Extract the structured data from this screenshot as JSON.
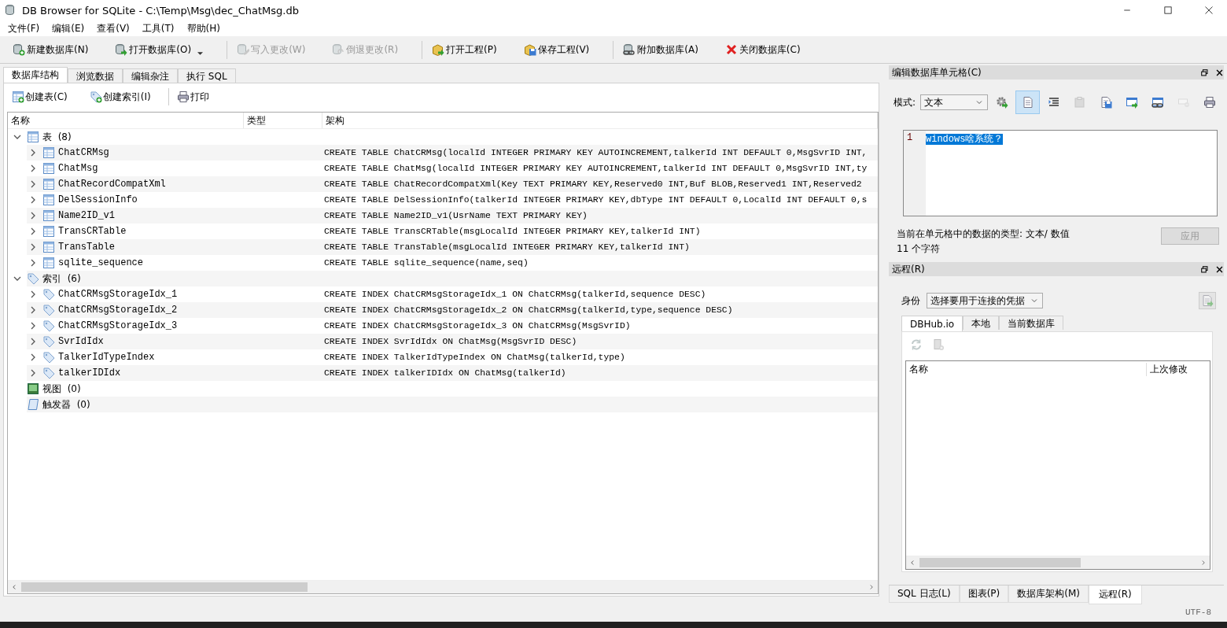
{
  "window": {
    "title": "DB Browser for SQLite - C:\\Temp\\Msg\\dec_ChatMsg.db"
  },
  "menu": [
    "文件(F)",
    "编辑(E)",
    "查看(V)",
    "工具(T)",
    "帮助(H)"
  ],
  "toolbar_groups": [
    {
      "buttons": [
        {
          "label": "新建数据库(N)",
          "disabled": false,
          "has_menu": false
        },
        {
          "label": "打开数据库(O)",
          "disabled": false,
          "has_menu": true
        }
      ]
    },
    {
      "buttons": [
        {
          "label": "写入更改(W)",
          "disabled": true,
          "has_menu": false
        },
        {
          "label": "倒退更改(R)",
          "disabled": true,
          "has_menu": false
        }
      ]
    },
    {
      "buttons": [
        {
          "label": "打开工程(P)",
          "disabled": false,
          "has_menu": false
        },
        {
          "label": "保存工程(V)",
          "disabled": false,
          "has_menu": false
        }
      ]
    },
    {
      "buttons": [
        {
          "label": "附加数据库(A)",
          "disabled": false,
          "has_menu": false
        },
        {
          "label": "关闭数据库(C)",
          "disabled": false,
          "has_menu": false
        }
      ]
    }
  ],
  "tabs": [
    {
      "label": "数据库结构",
      "selected": true
    },
    {
      "label": "浏览数据",
      "selected": false
    },
    {
      "label": "编辑杂注",
      "selected": false
    },
    {
      "label": "执行 SQL",
      "selected": false
    }
  ],
  "structure_toolbar": [
    "创建表(C)",
    "创建索引(I)",
    "打印"
  ],
  "tree": {
    "columns": [
      "名称",
      "类型",
      "架构"
    ],
    "groups": [
      {
        "label": "表",
        "count": "(8)",
        "expanded": true,
        "children": [
          {
            "name": "ChatCRMsg",
            "expanded": false,
            "schema": "CREATE TABLE ChatCRMsg(localId INTEGER PRIMARY KEY AUTOINCREMENT,talkerId INT DEFAULT 0,MsgSvrID INT,"
          },
          {
            "name": "ChatMsg",
            "expanded": false,
            "schema": "CREATE TABLE ChatMsg(localId INTEGER PRIMARY KEY AUTOINCREMENT,talkerId INT DEFAULT 0,MsgSvrID INT,ty"
          },
          {
            "name": "ChatRecordCompatXml",
            "expanded": false,
            "schema": "CREATE TABLE ChatRecordCompatXml(Key TEXT PRIMARY KEY,Reserved0 INT,Buf BLOB,Reserved1 INT,Reserved2"
          },
          {
            "name": "DelSessionInfo",
            "expanded": false,
            "schema": "CREATE TABLE DelSessionInfo(talkerId INTEGER PRIMARY KEY,dbType INT DEFAULT 0,LocalId INT DEFAULT 0,s"
          },
          {
            "name": "Name2ID_v1",
            "expanded": false,
            "schema": "CREATE TABLE Name2ID_v1(UsrName TEXT PRIMARY KEY)"
          },
          {
            "name": "TransCRTable",
            "expanded": false,
            "schema": "CREATE TABLE TransCRTable(msgLocalId INTEGER PRIMARY KEY,talkerId INT)"
          },
          {
            "name": "TransTable",
            "expanded": false,
            "schema": "CREATE TABLE TransTable(msgLocalId INTEGER PRIMARY KEY,talkerId INT)"
          },
          {
            "name": "sqlite_sequence",
            "expanded": false,
            "schema": "CREATE TABLE sqlite_sequence(name,seq)"
          }
        ]
      },
      {
        "label": "索引",
        "count": "(6)",
        "expanded": true,
        "children": [
          {
            "name": "ChatCRMsgStorageIdx_1",
            "expanded": false,
            "schema": "CREATE INDEX ChatCRMsgStorageIdx_1 ON ChatCRMsg(talkerId,sequence DESC)"
          },
          {
            "name": "ChatCRMsgStorageIdx_2",
            "expanded": false,
            "schema": "CREATE INDEX ChatCRMsgStorageIdx_2 ON ChatCRMsg(talkerId,type,sequence DESC)"
          },
          {
            "name": "ChatCRMsgStorageIdx_3",
            "expanded": false,
            "schema": "CREATE INDEX ChatCRMsgStorageIdx_3 ON ChatCRMsg(MsgSvrID)"
          },
          {
            "name": "SvrIdIdx",
            "expanded": false,
            "schema": "CREATE INDEX SvrIdIdx ON ChatMsg(MsgSvrID DESC)"
          },
          {
            "name": "TalkerIdTypeIndex",
            "expanded": false,
            "schema": "CREATE INDEX TalkerIdTypeIndex ON ChatMsg(talkerId,type)"
          },
          {
            "name": "talkerIDIdx",
            "expanded": false,
            "schema": "CREATE INDEX talkerIDIdx ON ChatMsg(talkerId)"
          }
        ]
      },
      {
        "label": "视图",
        "count": "(0)"
      },
      {
        "label": "触发器",
        "count": "(0)"
      }
    ]
  },
  "edit_cell": {
    "title": "编辑数据库单元格(C)",
    "mode_label": "模式:",
    "mode": "文本",
    "tools": [
      {
        "selected": false,
        "disabled": false
      },
      {
        "selected": true,
        "disabled": false
      },
      {
        "selected": false,
        "disabled": false
      },
      {
        "selected": false,
        "disabled": true
      },
      {
        "selected": false,
        "disabled": false
      },
      {
        "selected": false,
        "disabled": false
      },
      {
        "selected": false,
        "disabled": false
      },
      {
        "selected": false,
        "disabled": true
      },
      {
        "selected": false,
        "disabled": false
      }
    ],
    "editor": {
      "line_number": "1",
      "text": "windows啥系统？",
      "selected": true
    },
    "type_info": "当前在单元格中的数据的类型: 文本/ 数值",
    "char_count": "11 个字符",
    "apply": {
      "label": "应用",
      "disabled": true
    }
  },
  "remote": {
    "title": "远程(R)",
    "identity_label": "身份",
    "identity": "选择要用于连接的凭据",
    "tabs": [
      {
        "label": "DBHub.io",
        "selected": true
      },
      {
        "label": "本地",
        "selected": false
      },
      {
        "label": "当前数据库",
        "selected": false
      }
    ],
    "columns": [
      "名称",
      "上次修改"
    ]
  },
  "dock_tabs": [
    {
      "label": "SQL 日志(L)",
      "selected": false
    },
    {
      "label": "图表(P)",
      "selected": false
    },
    {
      "label": "数据库架构(M)",
      "selected": false
    },
    {
      "label": "远程(R)",
      "selected": true
    }
  ],
  "status_bar": {
    "encoding": "UTF-8"
  }
}
